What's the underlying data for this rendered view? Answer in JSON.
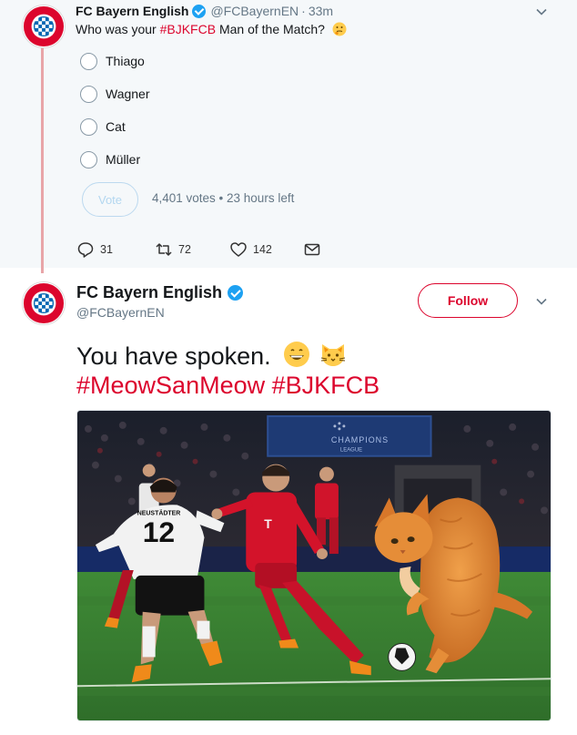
{
  "poll_tweet": {
    "display_name": "FC Bayern English",
    "handle": "@FCBayernEN",
    "separator": "·",
    "time": "33m",
    "text_before": "Who was your ",
    "hashtag": "#BJKFCB",
    "text_after": " Man of the Match?",
    "emoji": "thinking-face",
    "options": [
      "Thiago",
      "Wagner",
      "Cat",
      "Müller"
    ],
    "vote_label": "Vote",
    "poll_meta": "4,401 votes • 23 hours left",
    "actions": {
      "replies": "31",
      "retweets": "72",
      "likes": "142"
    }
  },
  "main_tweet": {
    "display_name": "FC Bayern English",
    "handle": "@FCBayernEN",
    "follow_label": "Follow",
    "line1": "You have spoken.",
    "line1_emojis": [
      "grinning-face",
      "cat-face"
    ],
    "line2": "#MeowSanMeow #BJKFCB",
    "photo": {
      "jersey_number": "12",
      "jersey_name": "NEUSTÄDTER",
      "board_text": "CHAMPIONS",
      "board_text_2": "LEAGUE"
    }
  },
  "colors": {
    "accent_red": "#dc052d",
    "verified_blue": "#1da1f2",
    "muted": "#657786",
    "quoted_bg": "#f5f8fa",
    "thread_line": "#e8a5a8"
  }
}
